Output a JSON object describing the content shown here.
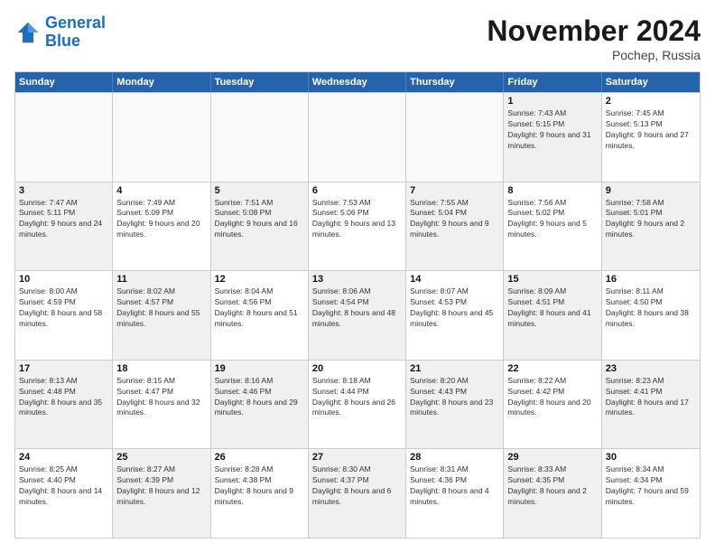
{
  "logo": {
    "line1": "General",
    "line2": "Blue"
  },
  "header": {
    "month_year": "November 2024",
    "location": "Pochep, Russia"
  },
  "days_of_week": [
    "Sunday",
    "Monday",
    "Tuesday",
    "Wednesday",
    "Thursday",
    "Friday",
    "Saturday"
  ],
  "rows": [
    [
      {
        "day": "",
        "info": "",
        "empty": true
      },
      {
        "day": "",
        "info": "",
        "empty": true
      },
      {
        "day": "",
        "info": "",
        "empty": true
      },
      {
        "day": "",
        "info": "",
        "empty": true
      },
      {
        "day": "",
        "info": "",
        "empty": true
      },
      {
        "day": "1",
        "info": "Sunrise: 7:43 AM\nSunset: 5:15 PM\nDaylight: 9 hours and 31 minutes.",
        "empty": false,
        "shaded": true
      },
      {
        "day": "2",
        "info": "Sunrise: 7:45 AM\nSunset: 5:13 PM\nDaylight: 9 hours and 27 minutes.",
        "empty": false,
        "shaded": false
      }
    ],
    [
      {
        "day": "3",
        "info": "Sunrise: 7:47 AM\nSunset: 5:11 PM\nDaylight: 9 hours and 24 minutes.",
        "empty": false,
        "shaded": true
      },
      {
        "day": "4",
        "info": "Sunrise: 7:49 AM\nSunset: 5:09 PM\nDaylight: 9 hours and 20 minutes.",
        "empty": false,
        "shaded": false
      },
      {
        "day": "5",
        "info": "Sunrise: 7:51 AM\nSunset: 5:08 PM\nDaylight: 9 hours and 16 minutes.",
        "empty": false,
        "shaded": true
      },
      {
        "day": "6",
        "info": "Sunrise: 7:53 AM\nSunset: 5:06 PM\nDaylight: 9 hours and 13 minutes.",
        "empty": false,
        "shaded": false
      },
      {
        "day": "7",
        "info": "Sunrise: 7:55 AM\nSunset: 5:04 PM\nDaylight: 9 hours and 9 minutes.",
        "empty": false,
        "shaded": true
      },
      {
        "day": "8",
        "info": "Sunrise: 7:56 AM\nSunset: 5:02 PM\nDaylight: 9 hours and 5 minutes.",
        "empty": false,
        "shaded": false
      },
      {
        "day": "9",
        "info": "Sunrise: 7:58 AM\nSunset: 5:01 PM\nDaylight: 9 hours and 2 minutes.",
        "empty": false,
        "shaded": true
      }
    ],
    [
      {
        "day": "10",
        "info": "Sunrise: 8:00 AM\nSunset: 4:59 PM\nDaylight: 8 hours and 58 minutes.",
        "empty": false,
        "shaded": false
      },
      {
        "day": "11",
        "info": "Sunrise: 8:02 AM\nSunset: 4:57 PM\nDaylight: 8 hours and 55 minutes.",
        "empty": false,
        "shaded": true
      },
      {
        "day": "12",
        "info": "Sunrise: 8:04 AM\nSunset: 4:56 PM\nDaylight: 8 hours and 51 minutes.",
        "empty": false,
        "shaded": false
      },
      {
        "day": "13",
        "info": "Sunrise: 8:06 AM\nSunset: 4:54 PM\nDaylight: 8 hours and 48 minutes.",
        "empty": false,
        "shaded": true
      },
      {
        "day": "14",
        "info": "Sunrise: 8:07 AM\nSunset: 4:53 PM\nDaylight: 8 hours and 45 minutes.",
        "empty": false,
        "shaded": false
      },
      {
        "day": "15",
        "info": "Sunrise: 8:09 AM\nSunset: 4:51 PM\nDaylight: 8 hours and 41 minutes.",
        "empty": false,
        "shaded": true
      },
      {
        "day": "16",
        "info": "Sunrise: 8:11 AM\nSunset: 4:50 PM\nDaylight: 8 hours and 38 minutes.",
        "empty": false,
        "shaded": false
      }
    ],
    [
      {
        "day": "17",
        "info": "Sunrise: 8:13 AM\nSunset: 4:48 PM\nDaylight: 8 hours and 35 minutes.",
        "empty": false,
        "shaded": true
      },
      {
        "day": "18",
        "info": "Sunrise: 8:15 AM\nSunset: 4:47 PM\nDaylight: 8 hours and 32 minutes.",
        "empty": false,
        "shaded": false
      },
      {
        "day": "19",
        "info": "Sunrise: 8:16 AM\nSunset: 4:46 PM\nDaylight: 8 hours and 29 minutes.",
        "empty": false,
        "shaded": true
      },
      {
        "day": "20",
        "info": "Sunrise: 8:18 AM\nSunset: 4:44 PM\nDaylight: 8 hours and 26 minutes.",
        "empty": false,
        "shaded": false
      },
      {
        "day": "21",
        "info": "Sunrise: 8:20 AM\nSunset: 4:43 PM\nDaylight: 8 hours and 23 minutes.",
        "empty": false,
        "shaded": true
      },
      {
        "day": "22",
        "info": "Sunrise: 8:22 AM\nSunset: 4:42 PM\nDaylight: 8 hours and 20 minutes.",
        "empty": false,
        "shaded": false
      },
      {
        "day": "23",
        "info": "Sunrise: 8:23 AM\nSunset: 4:41 PM\nDaylight: 8 hours and 17 minutes.",
        "empty": false,
        "shaded": true
      }
    ],
    [
      {
        "day": "24",
        "info": "Sunrise: 8:25 AM\nSunset: 4:40 PM\nDaylight: 8 hours and 14 minutes.",
        "empty": false,
        "shaded": false
      },
      {
        "day": "25",
        "info": "Sunrise: 8:27 AM\nSunset: 4:39 PM\nDaylight: 8 hours and 12 minutes.",
        "empty": false,
        "shaded": true
      },
      {
        "day": "26",
        "info": "Sunrise: 8:28 AM\nSunset: 4:38 PM\nDaylight: 8 hours and 9 minutes.",
        "empty": false,
        "shaded": false
      },
      {
        "day": "27",
        "info": "Sunrise: 8:30 AM\nSunset: 4:37 PM\nDaylight: 8 hours and 6 minutes.",
        "empty": false,
        "shaded": true
      },
      {
        "day": "28",
        "info": "Sunrise: 8:31 AM\nSunset: 4:36 PM\nDaylight: 8 hours and 4 minutes.",
        "empty": false,
        "shaded": false
      },
      {
        "day": "29",
        "info": "Sunrise: 8:33 AM\nSunset: 4:35 PM\nDaylight: 8 hours and 2 minutes.",
        "empty": false,
        "shaded": true
      },
      {
        "day": "30",
        "info": "Sunrise: 8:34 AM\nSunset: 4:34 PM\nDaylight: 7 hours and 59 minutes.",
        "empty": false,
        "shaded": false
      }
    ]
  ]
}
